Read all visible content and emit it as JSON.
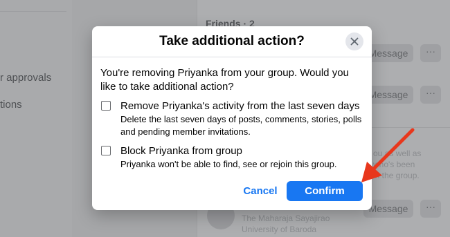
{
  "background": {
    "left_nav": [
      {
        "label": "r approvals"
      },
      {
        "label": "tions"
      }
    ],
    "friends_title": "Friends · 2",
    "message_label": "Message",
    "more_label": "···",
    "snippet_lines": [
      "ou as well as",
      "who's been",
      "in the group."
    ],
    "person_lines": [
      "The Maharaja Sayajirao",
      "University of Baroda"
    ]
  },
  "modal": {
    "title": "Take additional action?",
    "intro": "You're removing Priyanka from your group. Would you like to take additional action?",
    "options": [
      {
        "label": "Remove Priyanka's activity from the last seven days",
        "description": "Delete the last seven days of posts, comments, stories, polls and pending member invitations.",
        "checked": false
      },
      {
        "label": "Block Priyanka from group",
        "description": "Priyanka won't be able to find, see or rejoin this group.",
        "checked": false
      }
    ],
    "cancel_label": "Cancel",
    "confirm_label": "Confirm"
  },
  "icons": {
    "close": "close-icon",
    "annotation_arrow": "red-arrow-annotation"
  },
  "colors": {
    "accent": "#1877f2",
    "annotation": "#e8371c",
    "overlay_bg": "#a6a7a9"
  }
}
